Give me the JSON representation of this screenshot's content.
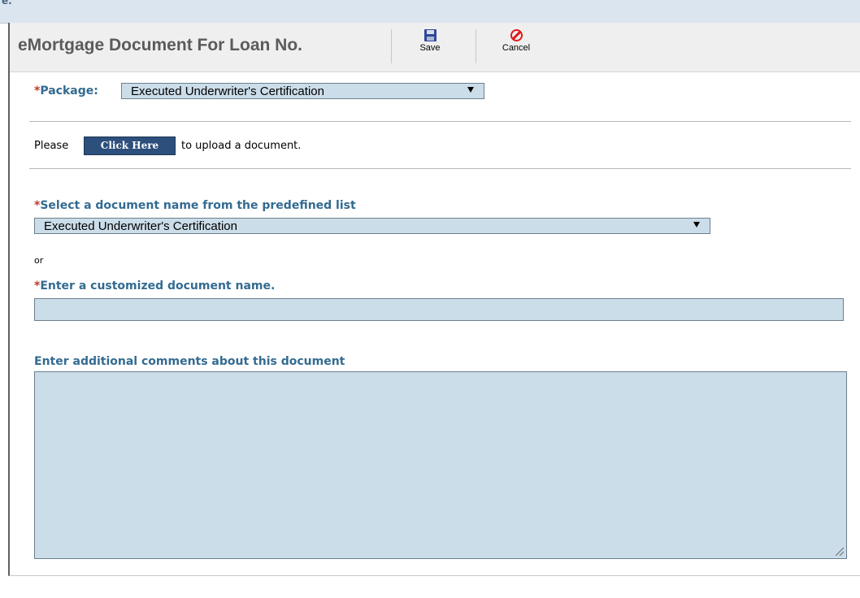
{
  "header_fragment": "e.",
  "dialog": {
    "title": "eMortgage Document For Loan No.",
    "toolbar": {
      "save": {
        "label": "Save",
        "icon": "floppy-disk-icon"
      },
      "cancel": {
        "label": "Cancel",
        "icon": "cancel-icon"
      }
    }
  },
  "package": {
    "required_mark": "*",
    "label": "Package:",
    "selected": "Executed Underwriter's Certification"
  },
  "upload": {
    "prefix": "Please",
    "button_label": "Click Here",
    "suffix": "to upload a document."
  },
  "document_name": {
    "required_mark": "*",
    "label": "Select a document name from the predefined list",
    "selected": "Executed Underwriter's Certification"
  },
  "or_text": "or",
  "custom_name": {
    "required_mark": "*",
    "label": "Enter a customized document name.",
    "value": ""
  },
  "comments": {
    "label": "Enter additional comments about this document",
    "value": ""
  },
  "colors": {
    "accent_blue": "#336b91",
    "required_red": "#c0392b",
    "field_bg": "#cbdde9",
    "button_bg": "#2c4f7c"
  }
}
